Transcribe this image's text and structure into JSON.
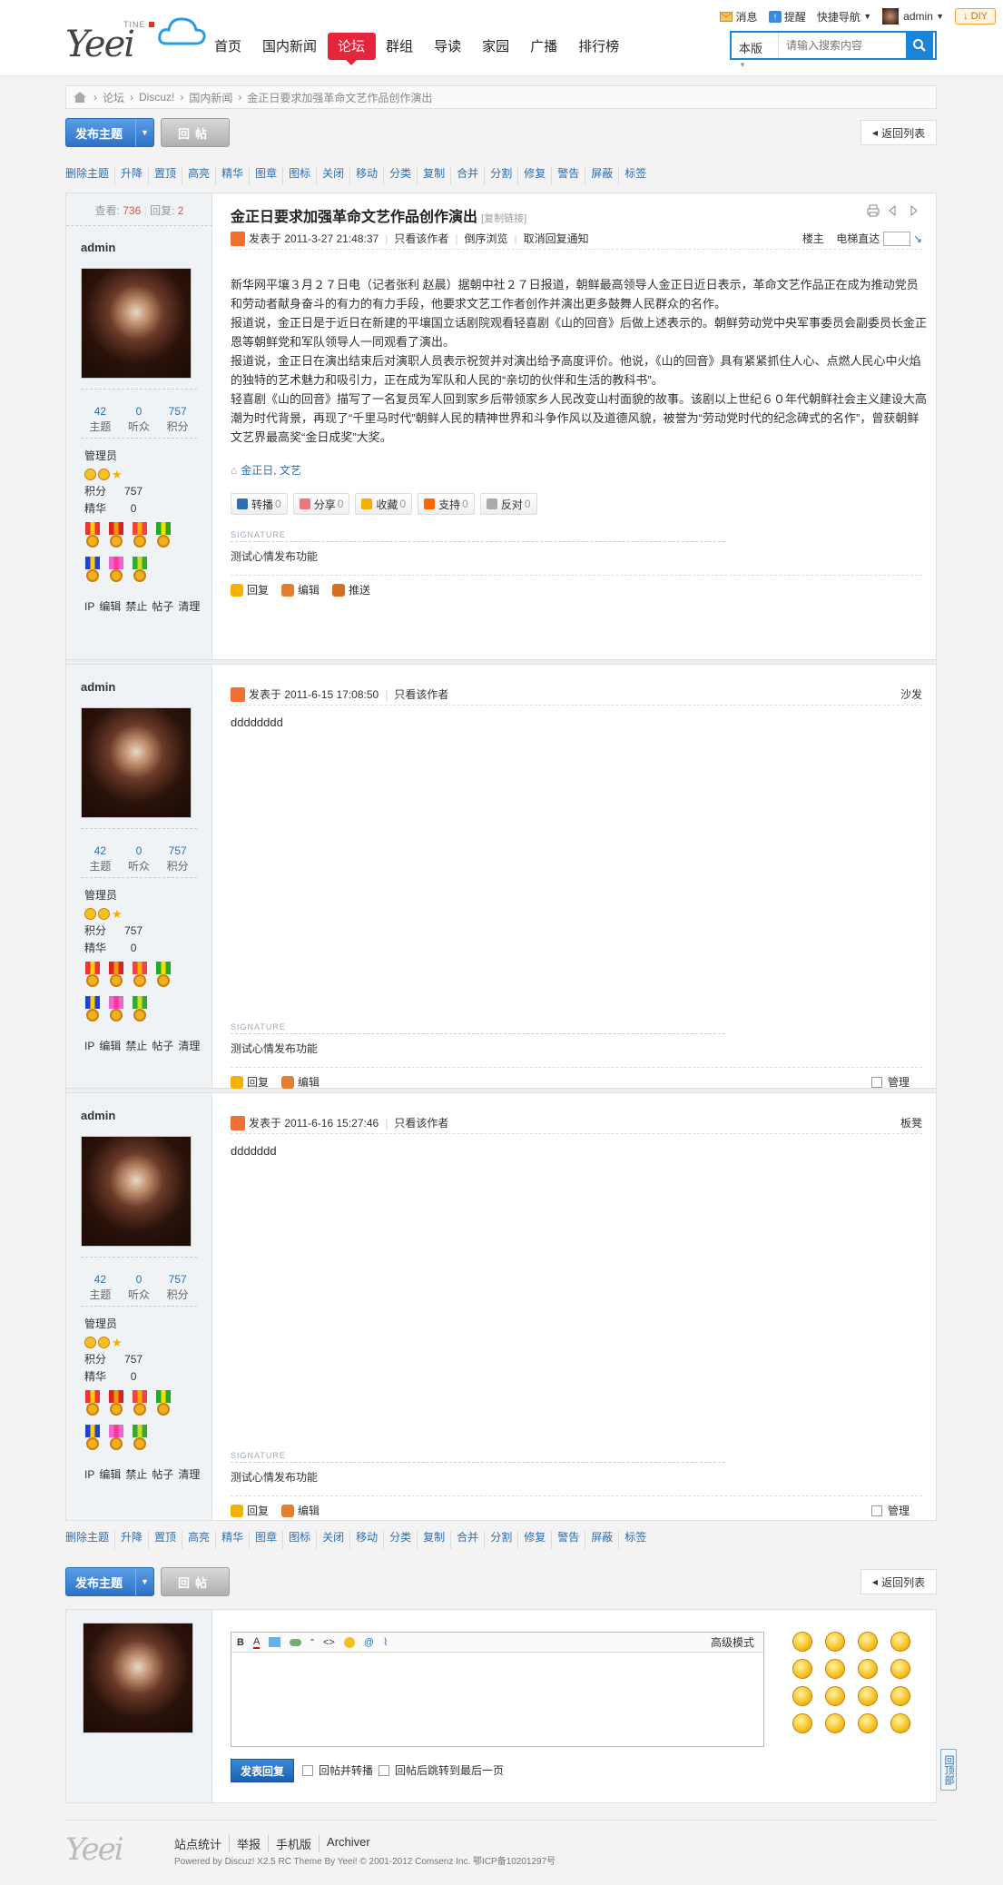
{
  "header": {
    "logo_text": "Yeei",
    "logo_sub": "TINE",
    "nav": [
      "首页",
      "国内新闻",
      "论坛",
      "群组",
      "导读",
      "家园",
      "广播",
      "排行榜"
    ],
    "nav_active": "论坛",
    "top_links": {
      "messages": "消息",
      "reminders": "提醒",
      "quick_nav": "快捷导航",
      "user": "admin",
      "diy": "DIY"
    },
    "search": {
      "scope": "本版",
      "placeholder": "请输入搜索内容"
    }
  },
  "breadcrumb": [
    "论坛",
    "Discuz!",
    "国内新闻",
    "金正日要求加强革命文艺作品创作演出"
  ],
  "toolbar": {
    "post_new": "发布主题",
    "reply": "回帖",
    "back": "返回列表"
  },
  "mod_links": [
    "删除主题",
    "升降",
    "置顶",
    "高亮",
    "精华",
    "图章",
    "图标",
    "关闭",
    "移动",
    "分类",
    "复制",
    "合并",
    "分割",
    "修复",
    "警告",
    "屏蔽",
    "标签"
  ],
  "thread": {
    "views_label": "查看:",
    "views": "736",
    "replies_label": "回复:",
    "replies": "2",
    "title": "金正日要求加强革命文艺作品创作演出",
    "copy_link": "[复制链接]"
  },
  "user_profile": {
    "name": "admin",
    "stats": [
      {
        "value": "42",
        "label": "主题"
      },
      {
        "value": "0",
        "label": "听众"
      },
      {
        "value": "757",
        "label": "积分"
      }
    ],
    "group": "管理员",
    "points_label": "积分",
    "points": "757",
    "digest_label": "精华",
    "digest": "0",
    "ops": [
      "IP",
      "编辑",
      "禁止",
      "帖子",
      "清理"
    ]
  },
  "posts": [
    {
      "time": "发表于 2011-3-27 21:48:37",
      "links": [
        "只看该作者",
        "倒序浏览",
        "取消回复通知"
      ],
      "floor": "楼主",
      "elevator": "电梯直达",
      "body": [
        "新华网平壤３月２７日电（记者张利 赵晨）据朝中社２７日报道，朝鲜最高领导人金正日近日表示，革命文艺作品正在成为推动党员和劳动者献身奋斗的有力的有力手段，他要求文艺工作者创作并演出更多鼓舞人民群众的名作。",
        "报道说，金正日是于近日在新建的平壤国立话剧院观看轻喜剧《山的回音》后做上述表示的。朝鲜劳动党中央军事委员会副委员长金正恩等朝鲜党和军队领导人一同观看了演出。",
        "报道说，金正日在演出结束后对演职人员表示祝贺并对演出给予高度评价。他说，《山的回音》具有紧紧抓住人心、点燃人民心中火焰的独特的艺术魅力和吸引力，正在成为军队和人民的“亲切的伙伴和生活的教科书”。",
        "轻喜剧《山的回音》描写了一名复员军人回到家乡后带领家乡人民改变山村面貌的故事。该剧以上世纪６０年代朝鲜社会主义建设大高潮为时代背景，再现了“千里马时代”朝鲜人民的精神世界和斗争作风以及道德风貌，被誉为“劳动党时代的纪念碑式的名作”，曾获朝鲜文艺界最高奖“金日成奖”大奖。"
      ],
      "tags": "金正日, 文艺",
      "share_buttons": [
        {
          "label": "转播",
          "count": "0"
        },
        {
          "label": "分享",
          "count": "0"
        },
        {
          "label": "收藏",
          "count": "0"
        },
        {
          "label": "支持",
          "count": "0"
        },
        {
          "label": "反对",
          "count": "0"
        }
      ],
      "signature_label": "SIGNATURE",
      "signature": "测试心情发布功能",
      "foot": [
        "回复",
        "编辑",
        "推送"
      ]
    },
    {
      "time": "发表于 2011-6-15 17:08:50",
      "links": [
        "只看该作者"
      ],
      "floor": "沙发",
      "body": [
        "dddddddd"
      ],
      "signature_label": "SIGNATURE",
      "signature": "测试心情发布功能",
      "foot": [
        "回复",
        "编辑"
      ],
      "manage": "管理"
    },
    {
      "time": "发表于 2011-6-16 15:27:46",
      "links": [
        "只看该作者"
      ],
      "floor": "板凳",
      "body": [
        "ddddddd"
      ],
      "signature_label": "SIGNATURE",
      "signature": "测试心情发布功能",
      "foot": [
        "回复",
        "编辑"
      ],
      "manage": "管理"
    }
  ],
  "fast_reply": {
    "advanced": "高级模式",
    "submit": "发表回复",
    "options": [
      "回帖并转播",
      "回帖后跳转到最后一页"
    ],
    "toolbar_glyphs": [
      "B",
      "A",
      "“",
      "<>",
      "@"
    ]
  },
  "footer": {
    "logo_text": "Yeei",
    "links": [
      "站点统计",
      "举报",
      "手机版",
      "Archiver"
    ],
    "copyright": "Powered by Discuz! X2.5 RC Theme By Yeei! © 2001-2012 Comsenz Inc. 鄂ICP备10201297号"
  },
  "gotop": "回顶部",
  "colors": {
    "accent": "#e6253b",
    "link": "#2b6fb5",
    "button_blue": "#2e72c8"
  }
}
